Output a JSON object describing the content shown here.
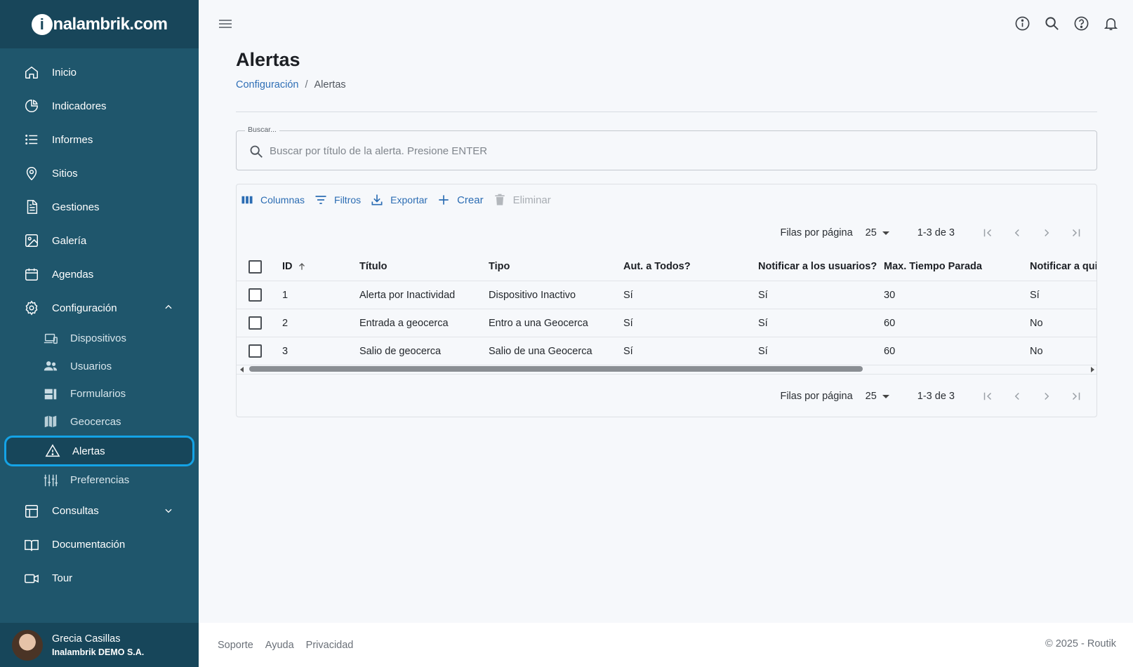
{
  "brand": {
    "logo_letter": "i",
    "logo_text": "nalambrik.com"
  },
  "sidebar": {
    "items": [
      {
        "label": "Inicio",
        "icon": "home-icon"
      },
      {
        "label": "Indicadores",
        "icon": "pie-chart-icon"
      },
      {
        "label": "Informes",
        "icon": "list-icon"
      },
      {
        "label": "Sitios",
        "icon": "location-pin-icon"
      },
      {
        "label": "Gestiones",
        "icon": "document-icon"
      },
      {
        "label": "Galería",
        "icon": "image-icon"
      },
      {
        "label": "Agendas",
        "icon": "calendar-icon"
      },
      {
        "label": "Configuración",
        "icon": "gear-icon",
        "expanded": true
      }
    ],
    "config_sub": [
      {
        "label": "Dispositivos",
        "icon": "devices-icon"
      },
      {
        "label": "Usuarios",
        "icon": "users-icon"
      },
      {
        "label": "Formularios",
        "icon": "forms-icon"
      },
      {
        "label": "Geocercas",
        "icon": "map-icon"
      },
      {
        "label": "Alertas",
        "icon": "warning-icon",
        "active": true
      },
      {
        "label": "Preferencias",
        "icon": "sliders-icon"
      }
    ],
    "bottom_items": [
      {
        "label": "Consultas",
        "icon": "table-icon",
        "expanded": false
      },
      {
        "label": "Documentación",
        "icon": "book-icon"
      },
      {
        "label": "Tour",
        "icon": "video-icon"
      }
    ]
  },
  "user": {
    "name": "Grecia Casillas",
    "org": "Inalambrik DEMO S.A."
  },
  "header": {
    "title": "Alertas",
    "breadcrumb": {
      "parent": "Configuración",
      "sep": "/",
      "current": "Alertas"
    }
  },
  "search": {
    "label": "Buscar...",
    "placeholder": "Buscar por título de la alerta. Presione ENTER",
    "value": ""
  },
  "toolbar": {
    "columns": "Columnas",
    "filters": "Filtros",
    "export": "Exportar",
    "create": "Crear",
    "delete": "Eliminar"
  },
  "pagination": {
    "rows_label": "Filas por página",
    "rows_value": "25",
    "range": "1-3 de 3"
  },
  "table": {
    "headers": [
      "ID",
      "Título",
      "Tipo",
      "Aut. a Todos?",
      "Notificar a los usuarios?",
      "Max. Tiempo Parada",
      "Notificar a qui"
    ],
    "rows": [
      [
        "1",
        "Alerta por Inactividad",
        "Dispositivo Inactivo",
        "Sí",
        "Sí",
        "30",
        "Sí"
      ],
      [
        "2",
        "Entrada a geocerca",
        "Entro a una Geocerca",
        "Sí",
        "Sí",
        "60",
        "No"
      ],
      [
        "3",
        "Salio de geocerca",
        "Salio de una Geocerca",
        "Sí",
        "Sí",
        "60",
        "No"
      ]
    ]
  },
  "footer": {
    "links": [
      "Soporte",
      "Ayuda",
      "Privacidad"
    ],
    "copyright": "© 2025 - Routik"
  },
  "colors": {
    "sidebar": "#1f566c",
    "sidebar_dark": "#17465a",
    "accent": "#2b6cb3",
    "active_outline": "#14a3e6"
  }
}
